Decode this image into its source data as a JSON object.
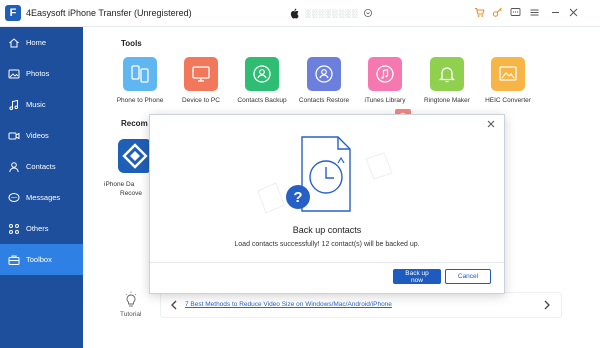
{
  "app": {
    "title": "4Easysoft iPhone Transfer (Unregistered)",
    "device_name": "░░░░░░░░"
  },
  "sidebar": {
    "items": [
      {
        "label": "Home",
        "icon": "home-icon"
      },
      {
        "label": "Photos",
        "icon": "photo-icon"
      },
      {
        "label": "Music",
        "icon": "music-icon"
      },
      {
        "label": "Videos",
        "icon": "video-icon"
      },
      {
        "label": "Contacts",
        "icon": "contacts-icon"
      },
      {
        "label": "Messages",
        "icon": "messages-icon"
      },
      {
        "label": "Others",
        "icon": "others-icon"
      },
      {
        "label": "Toolbox",
        "icon": "toolbox-icon",
        "active": true
      }
    ]
  },
  "tools": {
    "title": "Tools",
    "items": [
      {
        "label": "Phone to Phone",
        "color": "#5fb6f0"
      },
      {
        "label": "Device to PC",
        "color": "#f2785c"
      },
      {
        "label": "Contacts Backup",
        "color": "#2fbd73"
      },
      {
        "label": "Contacts Restore",
        "color": "#6c7fdc"
      },
      {
        "label": "iTunes Library",
        "color": "#f578b0"
      },
      {
        "label": "Ringtone Maker",
        "color": "#8fd04f"
      },
      {
        "label": "HEIC Converter",
        "color": "#f7b547"
      }
    ]
  },
  "recommended": {
    "title": "Recom",
    "app_label_line1": "iPhone Da",
    "app_label_line2": "Recove"
  },
  "tutorial": {
    "label": "Tutorial",
    "link": "7 Best Methods to Reduce Video Size on Windows/Mac/Android/iPhone"
  },
  "dialog": {
    "title": "Back up contacts",
    "message": "Load contacts successfully! 12 contact(s) will be backed up.",
    "primary_button": "Back up now",
    "cancel_button": "Cancel"
  },
  "colors": {
    "sidebar": "#1d4f9c",
    "sidebar_active": "#2e80e5",
    "accent": "#1e5bbf"
  }
}
